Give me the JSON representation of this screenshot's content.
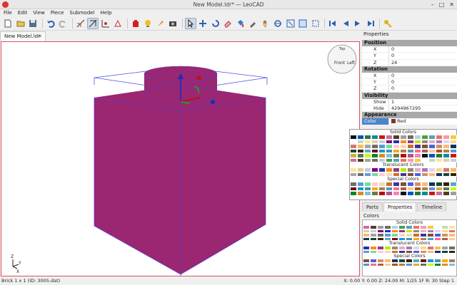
{
  "window": {
    "title": "New Model.ldr* — LeoCAD",
    "controls": [
      "–",
      "□",
      "✕"
    ]
  },
  "menu": [
    "File",
    "Edit",
    "View",
    "Piece",
    "Submodel",
    "Help"
  ],
  "document_tab": {
    "label": "New Model.ldr",
    "close": "✕"
  },
  "toolbar_icons": [
    "new-icon",
    "open-icon",
    "save-icon",
    "undo-icon",
    "redo-icon",
    "snap-icon",
    "snap-angle-icon",
    "snap-move-icon",
    "brick-icon",
    "light-icon",
    "spotlight-icon",
    "camera-icon",
    "select-icon",
    "move-icon",
    "rotate-icon",
    "eraser-icon",
    "paint-icon",
    "color-picker-icon",
    "pan-icon",
    "rotate-view-icon",
    "zoom-icon",
    "zoom-extents-icon",
    "zoom-region-icon",
    "first-step-icon",
    "previous-step-icon",
    "next-step-icon",
    "last-step-icon",
    "key-icon"
  ],
  "properties_panel": {
    "title": "Properties",
    "position": {
      "label": "Position",
      "rows": [
        [
          "X",
          "0"
        ],
        [
          "Y",
          "0"
        ],
        [
          "Z",
          "24"
        ]
      ]
    },
    "rotation": {
      "label": "Rotation",
      "rows": [
        [
          "X",
          "0"
        ],
        [
          "Y",
          "0"
        ],
        [
          "Z",
          "0"
        ]
      ]
    },
    "visibility": {
      "label": "Visibility",
      "rows": [
        [
          "Show",
          "1"
        ],
        [
          "Hide",
          "4294967295"
        ]
      ]
    },
    "appearance": {
      "label": "Appearance",
      "color_key": "Color",
      "color_value": "Red",
      "color_hex": "#c91a09"
    }
  },
  "color_popup": {
    "solid": "Solid Colors",
    "translucent": "Translucent Colors",
    "special": "Special Colors"
  },
  "tabs": {
    "parts": "Parts",
    "properties": "Properties",
    "timeline": "Timeline"
  },
  "colors_panel": {
    "title": "Colors",
    "solid": "Solid Colors",
    "translucent": "Translucent Colors",
    "special": "Special Colors"
  },
  "viewsphere": {
    "front": "Front",
    "left": "Left",
    "top": "Top"
  },
  "axes": {
    "x": "X",
    "y": "Y",
    "z": "Z"
  },
  "status": {
    "left": "Brick  1 x  1 (ID: 3005.dat)",
    "right": "X: 0.00 Y: 0.00 Z: 24.00   M: 1/25 1F R: 30   Step 1"
  },
  "palette": [
    "#05131d",
    "#0055bf",
    "#237841",
    "#008f9b",
    "#c91a09",
    "#c870a0",
    "#583927",
    "#9ba19d",
    "#6d6e5c",
    "#b4d2e3",
    "#4b9f4a",
    "#55a5af",
    "#f2705e",
    "#fc97ac",
    "#f2cd37",
    "#ffffff",
    "#c2dab8",
    "#fbe696",
    "#e4cd9e",
    "#c9cae2",
    "#81007b",
    "#2032b0",
    "#fe8a18",
    "#923978",
    "#bbe90b",
    "#958a73",
    "#e4adc8",
    "#ac78ba",
    "#e1d5ed",
    "#ffd67f",
    "#d67572",
    "#f9ba61",
    "#a0a5a9",
    "#6c6e68",
    "#5c9dd1",
    "#73dca1",
    "#fecccf",
    "#f6d7b3",
    "#cc702a",
    "#3f3691",
    "#7c503a",
    "#4c61db",
    "#d09168",
    "#feba74",
    "#0a3463",
    "#184632",
    "#352100",
    "#54a9c8",
    "#720e0f",
    "#1498d7",
    "#3e95b6",
    "#ffa70b",
    "#aa7d55",
    "#469bc3",
    "#ff698f",
    "#ad6140",
    "#ffc995",
    "#a95500",
    "#ac8247",
    "#5a93db",
    "#dbac34",
    "#577b43",
    "#c0ff00",
    "#00852b",
    "#dc8c16",
    "#7dbfdd",
    "#6a7944",
    "#b31004",
    "#ba4f8e",
    "#f785b1"
  ]
}
